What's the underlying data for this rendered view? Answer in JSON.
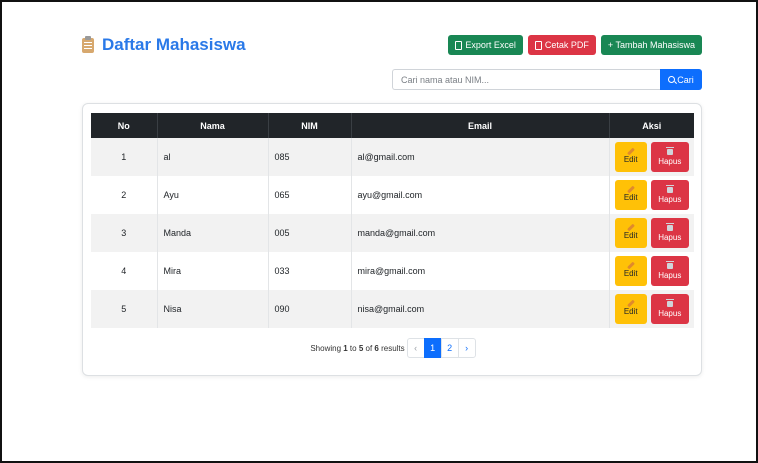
{
  "page": {
    "title": "Daftar Mahasiswa",
    "title_icon": "clipboard-icon"
  },
  "toolbar": {
    "export_excel_label": "Export Excel",
    "cetak_pdf_label": "Cetak PDF",
    "tambah_label": "+ Tambah Mahasiswa"
  },
  "search": {
    "value": "",
    "placeholder": "Cari nama atau NIM...",
    "button_label": "Cari"
  },
  "table": {
    "headers": [
      "No",
      "Nama",
      "NIM",
      "Email",
      "Aksi"
    ],
    "rows": [
      {
        "no": "1",
        "nama": "al",
        "nim": "085",
        "email": "al@gmail.com"
      },
      {
        "no": "2",
        "nama": "Ayu",
        "nim": "065",
        "email": "ayu@gmail.com"
      },
      {
        "no": "3",
        "nama": "Manda",
        "nim": "005",
        "email": "manda@gmail.com"
      },
      {
        "no": "4",
        "nama": "Mira",
        "nim": "033",
        "email": "mira@gmail.com"
      },
      {
        "no": "5",
        "nama": "Nisa",
        "nim": "090",
        "email": "nisa@gmail.com"
      }
    ],
    "edit_label": "Edit",
    "hapus_label": "Hapus"
  },
  "pagination": {
    "info_prefix": "Showing ",
    "from": "1",
    "to_word": " to ",
    "to": "5",
    "of_word": " of ",
    "total": "6",
    "results_word": " results",
    "prev": "‹",
    "pages": [
      "1",
      "2"
    ],
    "next": "›",
    "active_page": "1"
  },
  "colors": {
    "accent": "#2a79e8",
    "green": "#198754",
    "red": "#dc3545",
    "blue": "#0d6efd",
    "yellow": "#ffc107",
    "table_header": "#212529"
  }
}
